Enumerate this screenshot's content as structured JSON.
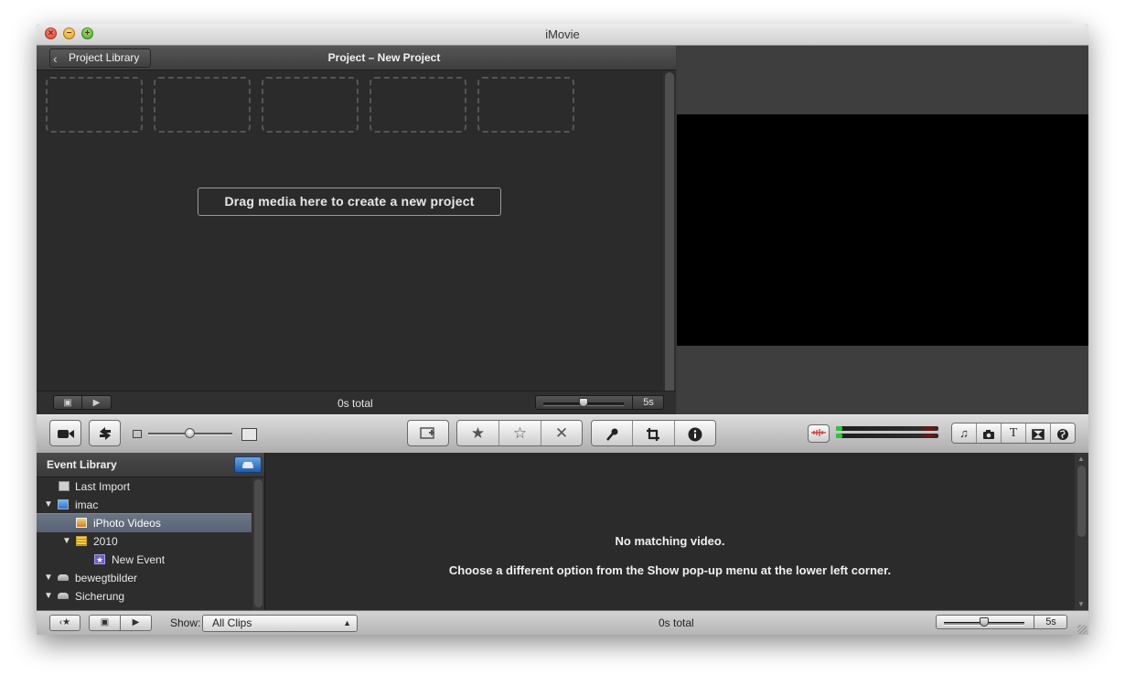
{
  "window": {
    "title": "iMovie"
  },
  "project": {
    "back_label": "Project Library",
    "title": "Project – New Project",
    "drag_hint": "Drag media here to create a new project",
    "total": "0s total",
    "zoom_label": "5s"
  },
  "toolbar": {
    "camera_icon": "camera-icon",
    "swap_icon": "swap-icon",
    "rating_icons": [
      "star-filled-icon",
      "star-outline-icon",
      "reject-x-icon"
    ],
    "tool_icons": [
      "microphone-icon",
      "crop-icon",
      "info-icon"
    ],
    "browser_icons": [
      "music-icon",
      "photo-icon",
      "title-icon",
      "transition-icon",
      "globe-icon"
    ],
    "audio_meter_color": "#25c93b"
  },
  "event_library": {
    "title": "Event Library",
    "items": [
      {
        "label": "Last Import",
        "icon": "last-import-icon",
        "expanded": null,
        "selected": false
      },
      {
        "label": "imac",
        "icon": "computer-icon",
        "expanded": true,
        "selected": false
      },
      {
        "label": "iPhoto Videos",
        "icon": "iphoto-icon",
        "expanded": null,
        "selected": true
      },
      {
        "label": "2010",
        "icon": "calendar-icon",
        "expanded": true,
        "selected": false
      },
      {
        "label": "New Event",
        "icon": "event-star-icon",
        "expanded": null,
        "selected": false
      },
      {
        "label": "bewegtbilder",
        "icon": "drive-icon",
        "expanded": true,
        "selected": false
      },
      {
        "label": "Sicherung",
        "icon": "drive-icon",
        "expanded": true,
        "selected": false
      }
    ]
  },
  "browser": {
    "message_title": "No matching video.",
    "message_body": "Choose a different option from the Show pop-up menu at the lower left corner."
  },
  "bottom": {
    "show_label": "Show:",
    "show_value": "All Clips",
    "total": "0s total",
    "zoom_label": "5s"
  },
  "colors": {
    "selection": "#5f6a7a",
    "library_button": "#3b7fd0",
    "close": "#d9331f",
    "minimize": "#d99a12",
    "zoom": "#3f9c1f"
  }
}
